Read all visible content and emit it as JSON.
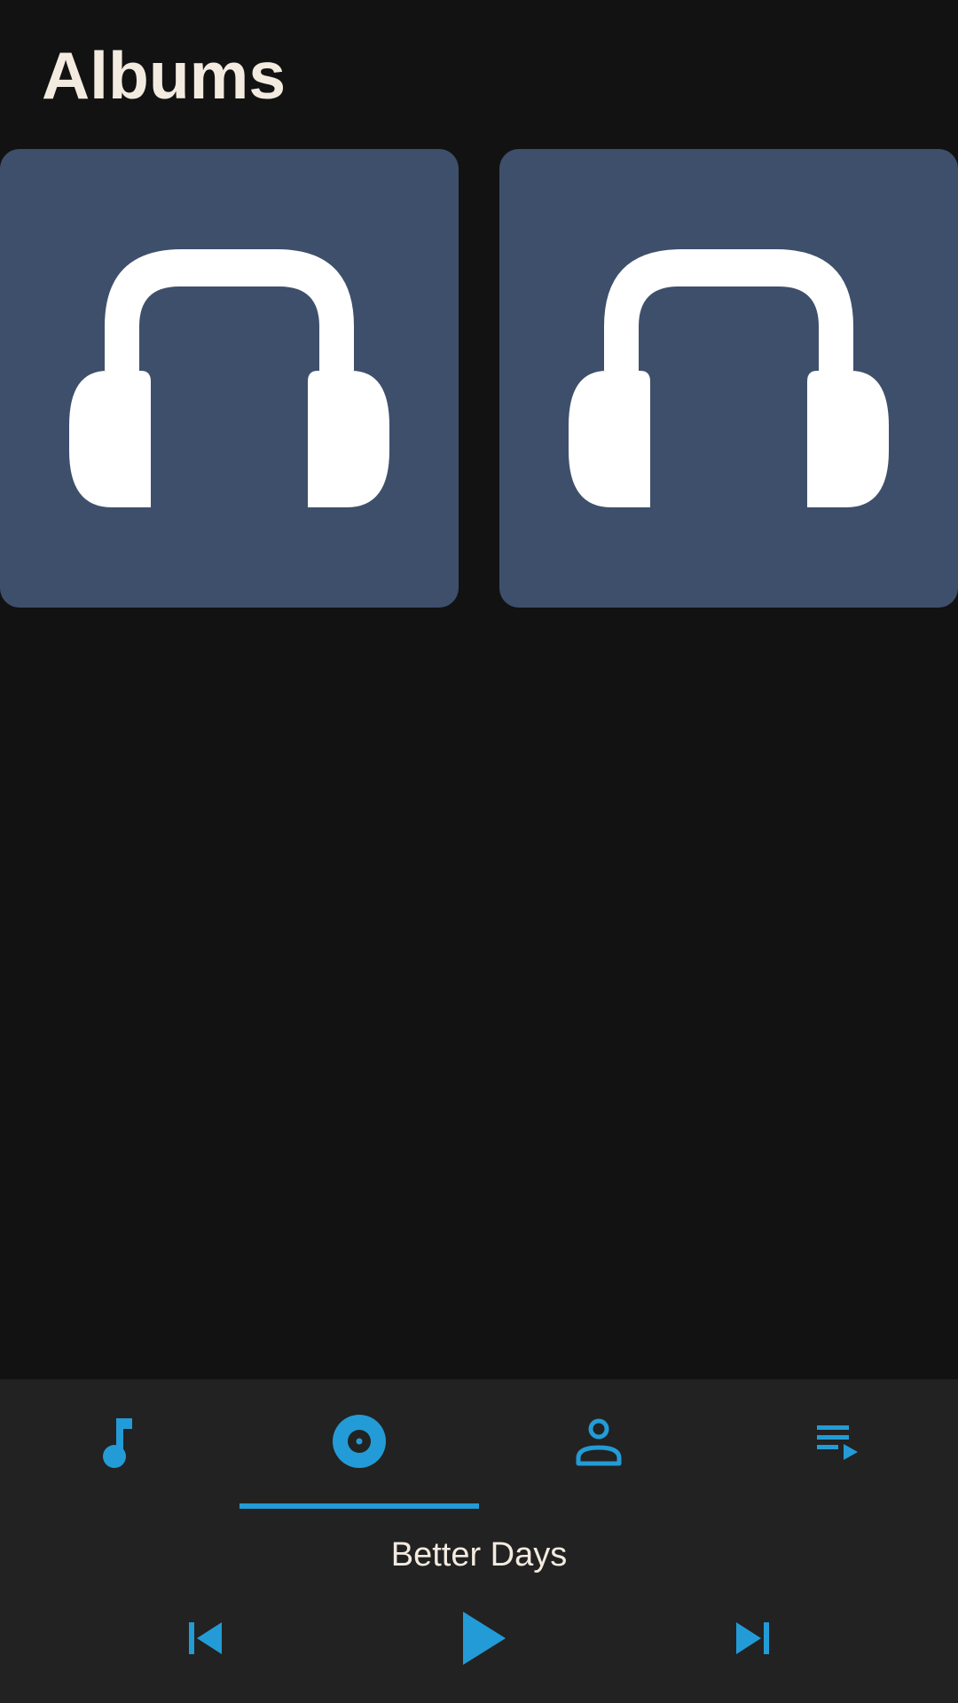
{
  "header": {
    "title": "Albums"
  },
  "albums": [
    {
      "art_icon": "headphones-icon"
    },
    {
      "art_icon": "headphones-icon"
    }
  ],
  "nav": {
    "tabs": [
      {
        "id": "songs",
        "icon": "music-note-icon"
      },
      {
        "id": "albums",
        "icon": "album-disc-icon",
        "selected": true
      },
      {
        "id": "artists",
        "icon": "person-icon"
      },
      {
        "id": "playlists",
        "icon": "playlist-play-icon"
      }
    ]
  },
  "player": {
    "now_playing_title": "Better Days",
    "controls": [
      "skip-previous-icon",
      "play-icon",
      "skip-next-icon"
    ]
  },
  "colors": {
    "background": "#121212",
    "panel": "#222222",
    "card": "#3e4f6b",
    "accent": "#239bd6",
    "text": "#f3ebe0"
  }
}
